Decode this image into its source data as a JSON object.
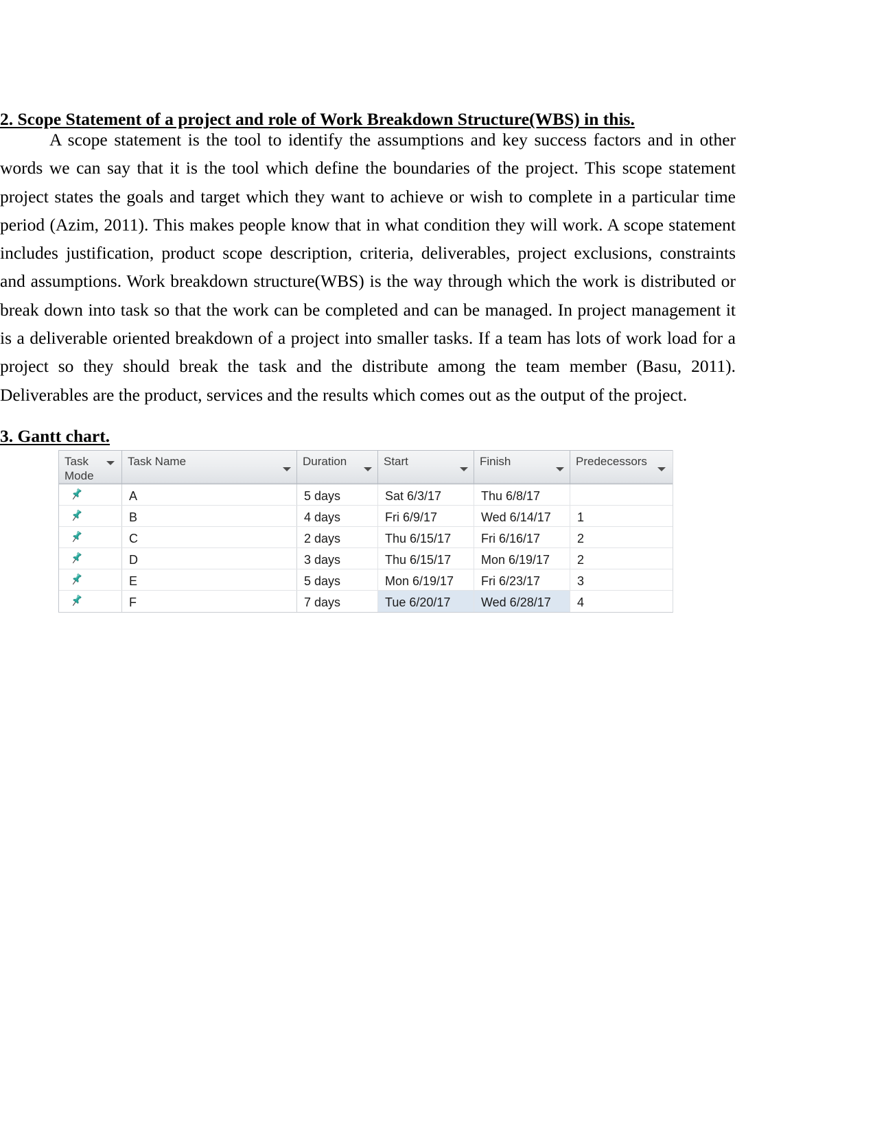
{
  "document": {
    "heading_scope": "2. Scope Statement of a project and role of Work Breakdown Structure(WBS) in this.",
    "paragraph": "A scope statement is the tool to identify the assumptions and key success factors and in other words we can say that it is the tool which define the boundaries of the project. This scope statement project states the goals and target which they want to achieve or wish to complete in a particular time period (Azim, 2011). This makes people know that in what condition they will work. A scope statement includes justification, product scope description, criteria, deliverables, project exclusions, constraints and assumptions.  Work breakdown structure(WBS) is the way through which the work is distributed or break down into task so that the work can be completed and can be managed. In project management it is a deliverable oriented breakdown of a project into smaller tasks. If a team has lots of work load for a project so they should break the task and the distribute among the team member (Basu, 2011). Deliverables are the product, services  and the results which comes out as the output of the project.",
    "heading_gantt": "3. Gantt chart."
  },
  "project_table": {
    "headers": {
      "task_mode_line1": "Task",
      "task_mode_line2": "Mode",
      "task_name": "Task Name",
      "duration": "Duration",
      "start": "Start",
      "finish": "Finish",
      "predecessors": "Predecessors"
    },
    "filter_icon": "chevron-down-icon",
    "mode_icon": "pushpin-icon",
    "selection_color": "#dce6f1",
    "pin_color": "#2aa79b",
    "rows": [
      {
        "mode": "pushpin-icon",
        "name": "A",
        "duration": "5 days",
        "start": "Sat 6/3/17",
        "finish": "Thu 6/8/17",
        "predecessors": "",
        "selected": false
      },
      {
        "mode": "pushpin-icon",
        "name": "B",
        "duration": "4 days",
        "start": "Fri 6/9/17",
        "finish": "Wed 6/14/17",
        "predecessors": "1",
        "selected": false
      },
      {
        "mode": "pushpin-icon",
        "name": "C",
        "duration": "2 days",
        "start": "Thu 6/15/17",
        "finish": "Fri 6/16/17",
        "predecessors": "2",
        "selected": false
      },
      {
        "mode": "pushpin-icon",
        "name": "D",
        "duration": "3 days",
        "start": "Thu 6/15/17",
        "finish": "Mon 6/19/17",
        "predecessors": "2",
        "selected": false
      },
      {
        "mode": "pushpin-icon",
        "name": "E",
        "duration": "5 days",
        "start": "Mon 6/19/17",
        "finish": "Fri 6/23/17",
        "predecessors": "3",
        "selected": false
      },
      {
        "mode": "pushpin-icon",
        "name": "F",
        "duration": "7 days",
        "start": "Tue 6/20/17",
        "finish": "Wed 6/28/17",
        "predecessors": "4",
        "selected": true
      }
    ]
  }
}
